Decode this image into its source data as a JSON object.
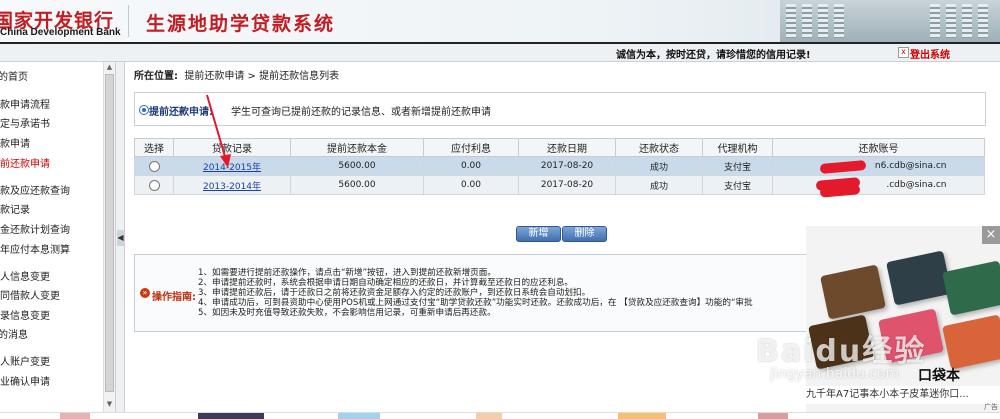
{
  "header": {
    "bank_name_cn": "国家开发银行",
    "bank_name_en": "China Development Bank",
    "system_title": "生源地助学贷款系统",
    "slogan": "诚信为本，按时还贷，请珍惜您的信用记录!",
    "logout_label": "登出系统"
  },
  "sidebar": {
    "items": [
      {
        "label": "我的首页",
        "active": false
      },
      {
        "label": "贷款申请流程",
        "active": false
      },
      {
        "label": "协定与承诺书",
        "active": false
      },
      {
        "label": "贷款申请",
        "active": false
      },
      {
        "label": "提前还款申请",
        "active": true
      },
      {
        "label": "贷款及应还款查询",
        "active": false
      },
      {
        "label": "还款记录",
        "active": false
      },
      {
        "label": "本金还款计划查询",
        "active": false
      },
      {
        "label": "当年应付本息测算",
        "active": false
      },
      {
        "label": "个人信息变更",
        "active": false
      },
      {
        "label": "共同借款人变更",
        "active": false
      },
      {
        "label": "登录信息变更",
        "active": false
      },
      {
        "label": "我的消息",
        "active": false
      },
      {
        "label": "个人账户变更",
        "active": false
      },
      {
        "label": "毕业确认申请",
        "active": false
      }
    ]
  },
  "breadcrumb": {
    "prefix": "所在位置:",
    "path": "提前还款申请 > 提前还款信息列表"
  },
  "notice": {
    "title": "提前还款申请:",
    "text": "学生可查询已提前还款的记录信息、或者新增提前还款申请"
  },
  "table": {
    "headers": [
      "选择",
      "贷款记录",
      "提前还款本金",
      "应付利息",
      "还款日期",
      "还款状态",
      "代理机构",
      "还款账号"
    ],
    "rows": [
      {
        "record": "2014-2015年",
        "principal": "5600.00",
        "interest": "0.00",
        "date": "2017-08-20",
        "status": "成功",
        "agency": "支付宝",
        "account": "n6.cdb@sina.cn"
      },
      {
        "record": "2013-2014年",
        "principal": "5600.00",
        "interest": "0.00",
        "date": "2017-08-20",
        "status": "成功",
        "agency": "支付宝",
        "account": ".cdb@sina.cn"
      }
    ]
  },
  "buttons": {
    "add": "新增",
    "delete": "删除"
  },
  "guide": {
    "title": "操作指南:",
    "lines": [
      "1、如需要进行提前还款操作，请点击“新增”按钮，进入到提前还款新增页面。",
      "2、申请提前还款时，系统会根据申请日期自动确定相应的还款日，并计算截至还款日的应还利息。",
      "3、申请提前还款后，请于还款日之前将还款资金足额存入约定的还款账户，到还款日系统会自动划扣。",
      "4、申请成功后，可到县资助中心使用POS机或上网通过支付宝“助学贷款还款”功能实时还款。还款成功后，在 【贷款及应还款查询】功能的“审批",
      "5、如因未及时充值导致还款失败，不会影响信用记录，可重新申请后再还款。"
    ]
  },
  "ad": {
    "label": "口袋本",
    "caption": "九千年A7记事本小本子皮革迷你口...",
    "tag": "广告",
    "close": "×"
  },
  "watermark": {
    "text": "Baidu经验",
    "url": "jingyan.baidu.com"
  },
  "colors": {
    "brand_red": "#c21d23",
    "link_blue": "#1a3fa8",
    "selected_row": "#c9daea",
    "button_blue": "#3f6fae",
    "annotation_red": "#e4192b"
  }
}
